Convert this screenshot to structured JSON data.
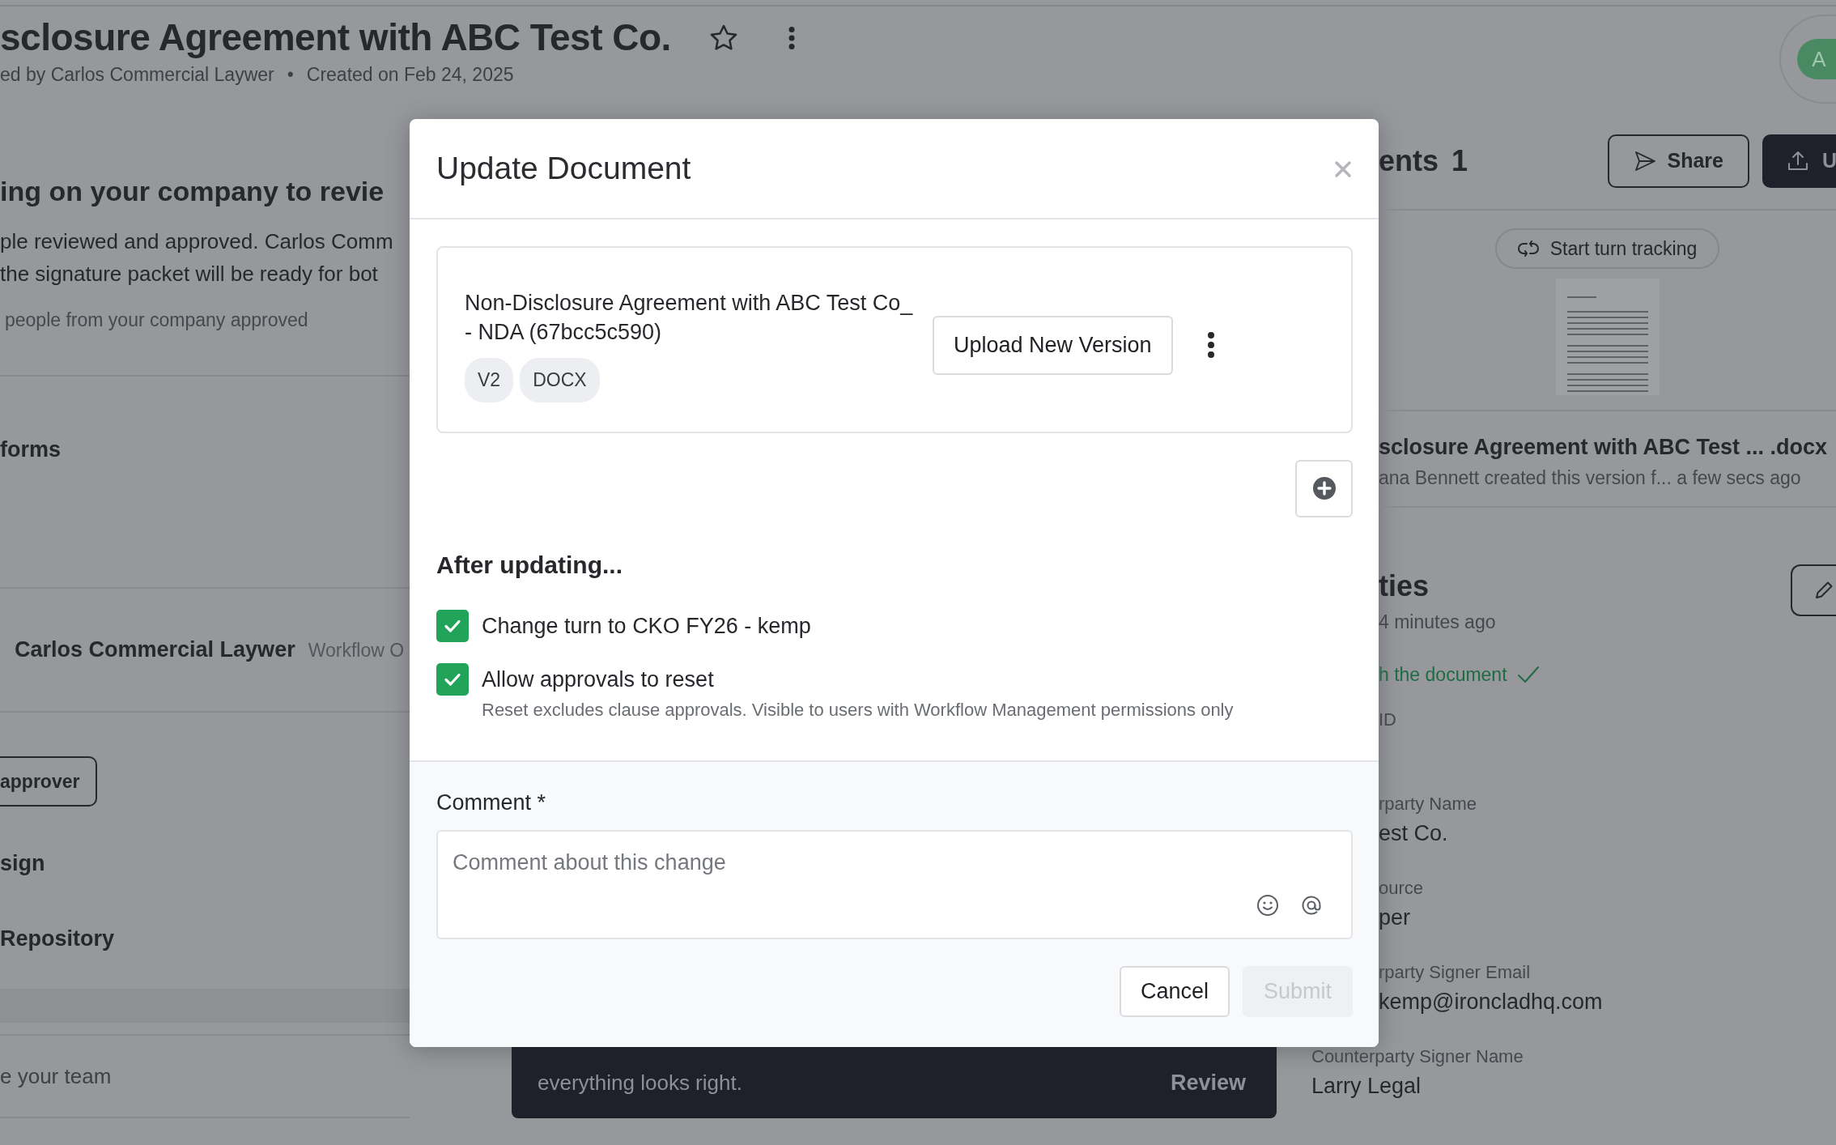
{
  "page_header": {
    "title": "sclosure Agreement with ABC Test Co.",
    "byline": "ed by Carlos Commercial Laywer",
    "separator": "•",
    "created": "Created on Feb 24, 2025",
    "avatar_initial": "A"
  },
  "left_panel": {
    "heading": "ing on your company to revie",
    "lines": [
      "ple reviewed and approved. Carlos Comm",
      "the signature packet will be ready for bot"
    ],
    "approval_note": "people from your company approved",
    "items": [
      {
        "kind": "section",
        "text": "forms"
      },
      {
        "kind": "person",
        "name": "Carlos Commercial Laywer",
        "role": "Workflow O"
      },
      {
        "kind": "button",
        "text": "approver"
      },
      {
        "kind": "section",
        "text": "sign"
      },
      {
        "kind": "section",
        "text": "Repository"
      },
      {
        "kind": "note",
        "text": "e your team"
      }
    ]
  },
  "modal": {
    "title": "Update Document",
    "file": {
      "name": "Non-Disclosure Agreement with ABC Test Co_ - NDA (67bcc5c590)",
      "tags": [
        "V2",
        "DOCX"
      ],
      "upload": "Upload New Version"
    },
    "after_heading": "After updating...",
    "options": [
      {
        "label": "Change turn to CKO FY26 - kemp",
        "checked": true
      },
      {
        "label": "Allow approvals to reset",
        "checked": true,
        "hint": "Reset excludes clause approvals. Visible to users with Workflow Management permissions only"
      }
    ],
    "comment": {
      "label": "Comment *",
      "placeholder": "Comment about this change"
    },
    "buttons": [
      {
        "label": "Cancel",
        "disabled": false
      },
      {
        "label": "Submit",
        "disabled": true
      }
    ]
  },
  "toast": {
    "text": "everything looks right.",
    "action": "Review"
  },
  "documents": {
    "heading": "ents",
    "count": "1",
    "share": "Share",
    "upload": "U",
    "turn_tracking": "Start turn tracking",
    "file_name": "sclosure Agreement with ABC Test ... .docx",
    "file_meta": "ana Bennett created this version f... a few secs ago"
  },
  "properties": {
    "heading": "ties",
    "updated": "4 minutes ago",
    "synced": "h the document",
    "fields": [
      {
        "kind": "covered",
        "label": "ID"
      },
      {
        "kind": "covered",
        "label": "rparty Name",
        "value": "est Co."
      },
      {
        "kind": "covered",
        "label": "ource",
        "value": "per"
      },
      {
        "kind": "covered",
        "label": "rparty Signer Email",
        "value": "kemp@ironcladhq.com"
      },
      {
        "kind": "full",
        "label": "Counterparty Signer Name",
        "value": "Larry Legal"
      }
    ]
  }
}
